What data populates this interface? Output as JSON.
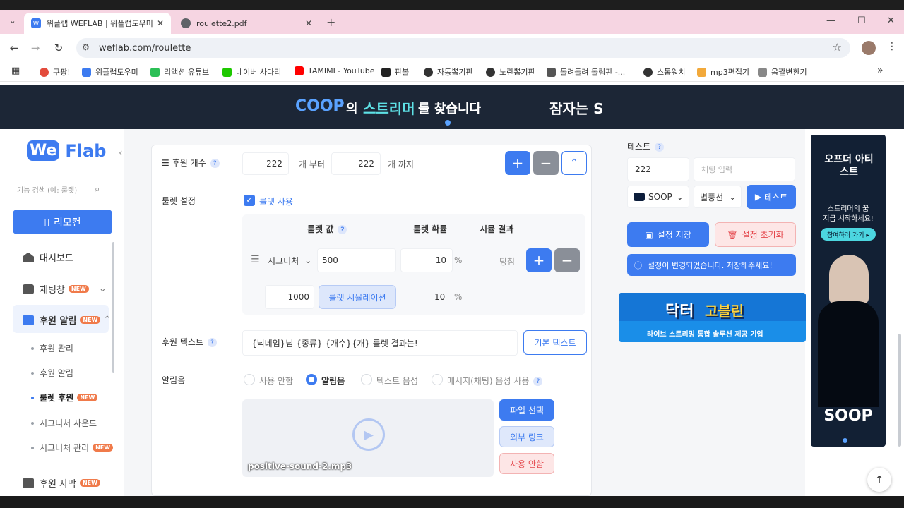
{
  "browser": {
    "tabs": [
      {
        "title": "위플랩 WEFLAB | 위플랩도우미",
        "active": true
      },
      {
        "title": "roulette2.pdf",
        "active": false
      }
    ],
    "new_tab": "+",
    "url": "weflab.com/roulette",
    "bookmarks": [
      "쿠팡!",
      "위플랩도우미",
      "리액션 유튜브",
      "네이버 사다리",
      "TAMIMI - YouTube",
      "판볼",
      "자동뽑기판",
      "노란뽑기판",
      "돌려돌려 돌림판 -...",
      "스톱워치",
      "mp3편집기",
      "옴짤변환기"
    ],
    "more": "»"
  },
  "banner": {
    "text1": "의",
    "brand": "COOP",
    "text2": "스트리머",
    "text3": "를 찾습니다",
    "text4": "잠자는 S"
  },
  "sidebar": {
    "logo1": "We",
    "logo2": "Flab",
    "search_placeholder": "기능 검색 (예: 룰렛)",
    "remote_label": "리모컨",
    "items": [
      {
        "label": "대시보드"
      },
      {
        "label": "채팅창",
        "badge": "NEW"
      },
      {
        "label": "후원 알림",
        "badge": "NEW"
      }
    ],
    "subitems": [
      {
        "label": "후원 관리"
      },
      {
        "label": "후원 알림"
      },
      {
        "label": "룰렛 후원",
        "badge": "NEW"
      },
      {
        "label": "시그니처 사운드"
      },
      {
        "label": "시그니처 관리",
        "badge": "NEW"
      }
    ],
    "last_item": {
      "label": "후원 자막",
      "badge": "NEW"
    }
  },
  "form": {
    "count": {
      "label": "후원 개수",
      "from": "222",
      "from_unit": "개 부터",
      "to": "222",
      "to_unit": "개 까지"
    },
    "roulette": {
      "label": "룰렛 설정",
      "use_label": "룰렛 사용",
      "headers": [
        "룰렛 값",
        "룰렛 확률",
        "시뮬 결과"
      ],
      "row": {
        "type": "시그니처",
        "value": "500",
        "prob": "10",
        "unit": "%",
        "result": "당첨"
      },
      "sim": {
        "count": "1000",
        "button": "룰렛 시뮬레이션",
        "prob": "10",
        "unit": "%"
      }
    },
    "text": {
      "label": "후원 텍스트",
      "value": "{닉네임}님 {종류} {개수}{개} 룰렛 결과는!",
      "default_btn": "기본 텍스트"
    },
    "sound": {
      "label": "알림음",
      "options": [
        "사용 안함",
        "알림음",
        "텍스트 음성",
        "메시지(채팅) 음성 사용"
      ],
      "selected": "알림음",
      "file": "positive-sound-2.mp3",
      "file_btn": "파일 선택",
      "link_btn": "외부 링크",
      "off_btn": "사용 안함"
    }
  },
  "test": {
    "label": "테스트",
    "amount": "222",
    "chat_placeholder": "채팅 입력",
    "platform": "SOOP",
    "kind": "별풍선",
    "test_btn": "테스트",
    "save_btn": "설정 저장",
    "reset_btn": "설정 초기화",
    "notice": "설정이 변경되었습니다. 저장해주세요!"
  },
  "promo": {
    "title1": "닥터",
    "title2": "고블린",
    "sub": "라이브 스트리밍 통합 솔루션 제공 기업"
  },
  "ad": {
    "title": "오프더 아티스트",
    "line1": "스트리머의 꿈",
    "line2": "지금 시작하세요!",
    "cta": "참여하러 가기 ▸",
    "brand": "SOOP"
  },
  "colors": {
    "accent": "#3d7bf0",
    "danger": "#e5484d",
    "badge": "#f07a4a"
  }
}
